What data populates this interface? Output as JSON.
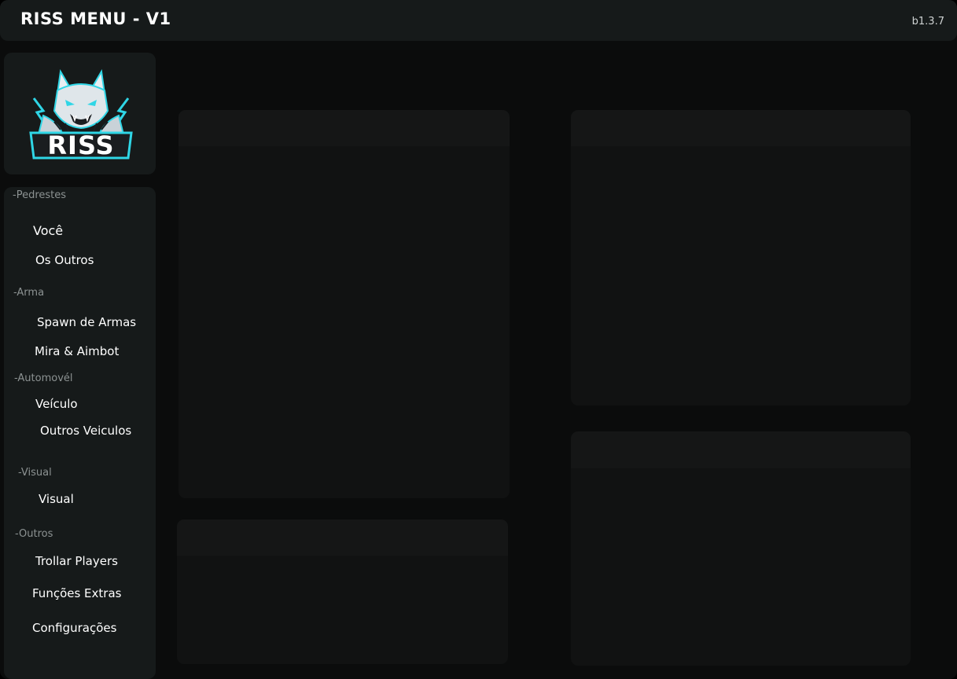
{
  "app": {
    "title": "RISS MENU - V1",
    "version": "b1.3.7"
  },
  "logo": {
    "text": "RISS",
    "accent_color": "#2fd6e6"
  },
  "sidebar": {
    "sections": [
      {
        "label": "-Pedrestes",
        "items": [
          {
            "label": "Você"
          },
          {
            "label": "Os Outros"
          }
        ]
      },
      {
        "label": "-Arma",
        "items": [
          {
            "label": "Spawn de Armas"
          },
          {
            "label": "Mira & Aimbot"
          }
        ]
      },
      {
        "label": "-Automovél",
        "items": [
          {
            "label": "Veículo"
          },
          {
            "label": "Outros Veiculos"
          }
        ]
      },
      {
        "label": "-Visual",
        "items": [
          {
            "label": "Visual"
          }
        ]
      },
      {
        "label": "-Outros",
        "items": [
          {
            "label": "Trollar Players"
          },
          {
            "label": "Funções Extras"
          },
          {
            "label": "Configurações"
          }
        ]
      }
    ]
  },
  "colors": {
    "background": "#0b0c0c",
    "card": "#161a1a",
    "panel": "#111212",
    "panel_header": "#151616",
    "text": "#ffffff",
    "section_text": "#8c9292"
  }
}
